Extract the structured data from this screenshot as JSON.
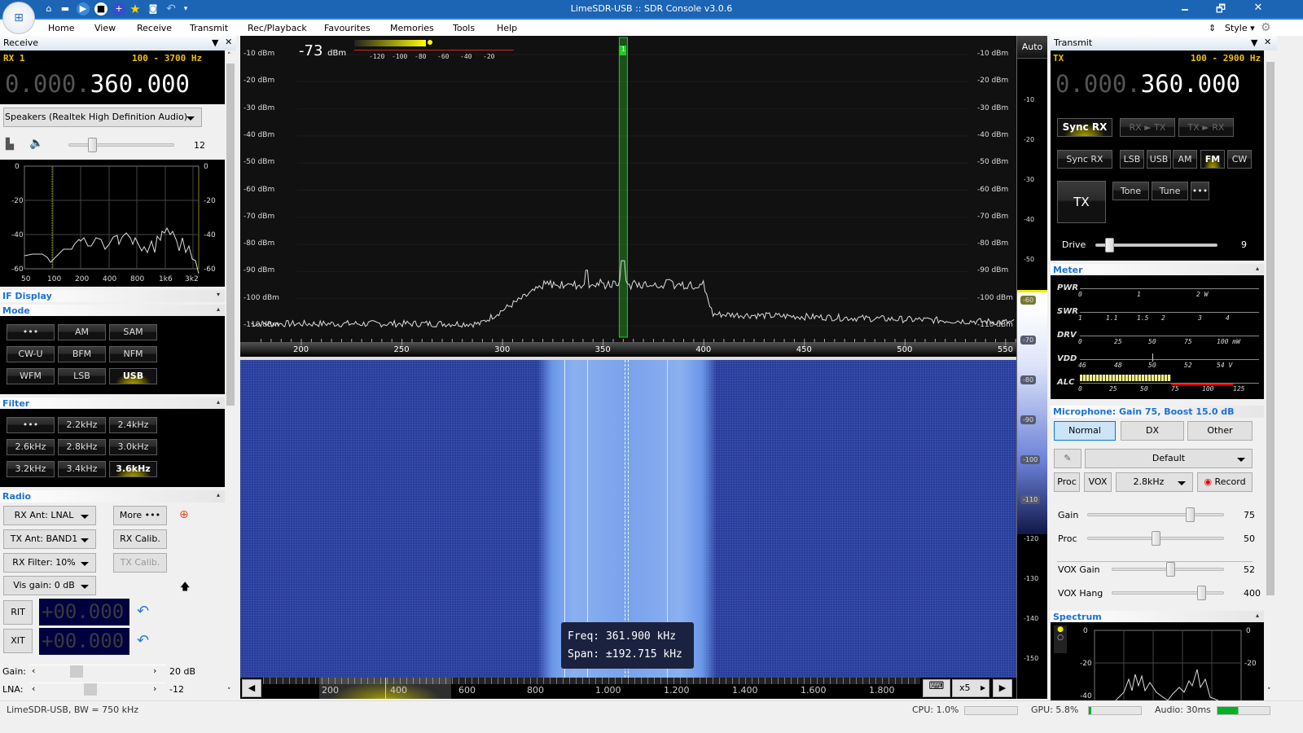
{
  "window": {
    "title": "LimeSDR-USB :: SDR Console v3.0.6",
    "minimize": "🗕",
    "restore": "🗗",
    "close": "✕"
  },
  "quick_access": [
    "home-icon",
    "folder-icon",
    "play-icon",
    "stop-icon",
    "add-icon",
    "favourite-star-icon",
    "camera-icon",
    "undo-icon"
  ],
  "menu": {
    "items": [
      "Home",
      "View",
      "Receive",
      "Transmit",
      "Rec/Playback",
      "Favourites",
      "Memories",
      "Tools",
      "Help"
    ],
    "style": "Style"
  },
  "receive": {
    "title": "Receive",
    "rx_label": "RX 1",
    "bandwidth": "100 - 3700 Hz",
    "freq_dim": "0.000.",
    "freq": "360.000",
    "audio_device": "Speakers (Realtek High Definition Audio)",
    "volume": "12",
    "volume_level": 0.22,
    "audio_y_labels": [
      "0",
      "-20",
      "-40",
      "-60"
    ],
    "audio_x_labels": [
      "50",
      "100",
      "200",
      "400",
      "800",
      "1k6",
      "3k2"
    ],
    "if_display": "IF Display",
    "mode_title": "Mode",
    "modes": [
      "•••",
      "AM",
      "SAM",
      "CW-U",
      "BFM",
      "NFM",
      "WFM",
      "LSB",
      "USB"
    ],
    "mode_selected": "USB",
    "filter_title": "Filter",
    "filters": [
      "•••",
      "2.2kHz",
      "2.4kHz",
      "2.6kHz",
      "2.8kHz",
      "3.0kHz",
      "3.2kHz",
      "3.4kHz",
      "3.6kHz"
    ],
    "filter_selected": "3.6kHz",
    "radio_title": "Radio",
    "rx_ant": "RX Ant: LNAL",
    "tx_ant": "TX Ant: BAND1",
    "rx_filter": "RX Filter: 10%",
    "vis_gain": "Vis gain: 0 dB",
    "more": "More •••",
    "rx_calib": "RX Calib.",
    "tx_calib": "TX Calib.",
    "rit": "RIT",
    "xit": "XIT",
    "rit_value": "+00.000",
    "xit_value": "+00.000",
    "gain_label": "Gain:",
    "gain_value": "20 dB",
    "lna_label": "LNA:",
    "lna_value": "-12"
  },
  "spectrum": {
    "level": "-73",
    "level_unit": "dBm",
    "meter_ticks": [
      "-120",
      "-100",
      "-80",
      "-60",
      "-40",
      "-20"
    ],
    "y_labels": [
      "-10 dBm",
      "-20 dBm",
      "-30 dBm",
      "-40 dBm",
      "-50 dBm",
      "-60 dBm",
      "-70 dBm",
      "-80 dBm",
      "-90 dBm",
      "-100 dBm",
      "-110 dBm"
    ],
    "x_labels": [
      "200",
      "250",
      "300",
      "350",
      "400",
      "450",
      "500",
      "550"
    ],
    "marker": "1",
    "auto": "Auto",
    "scale_labels": [
      "-10",
      "-20",
      "-30",
      "-40",
      "-50",
      "-60",
      "-70",
      "-80",
      "-90",
      "-100",
      "-110",
      "-120",
      "-130",
      "-140",
      "-150"
    ]
  },
  "waterfall": {
    "freq_label": "Freq:",
    "freq_value": "361.900 kHz",
    "span_label": "Span:",
    "span_value": "±192.715 kHz",
    "overview_labels": [
      "200",
      "400",
      "600",
      "800",
      "1.000",
      "1.200",
      "1.400",
      "1.600",
      "1.800"
    ],
    "zoom": "x5"
  },
  "transmit": {
    "title": "Transmit",
    "tx_label": "TX",
    "bandwidth": "100 - 2900 Hz",
    "freq_dim": "0.000.",
    "freq": "360.000",
    "sync_rx": "Sync RX",
    "rx_to_tx": "RX ► TX",
    "tx_to_rx": "TX ► RX",
    "sync_rx2": "Sync RX",
    "modes": [
      "LSB",
      "USB",
      "AM",
      "FM",
      "CW"
    ],
    "mode_selected": "FM",
    "tx": "TX",
    "tone": "Tone",
    "tune": "Tune",
    "more": "•••",
    "drive_label": "Drive",
    "drive_value": "9",
    "drive_level": 0.09
  },
  "meter": {
    "title": "Meter",
    "rows": [
      {
        "label": "PWR",
        "ticks": [
          "0",
          "1",
          "2 W"
        ]
      },
      {
        "label": "SWR",
        "ticks": [
          "1",
          "1.1",
          "1.5",
          "2",
          "3",
          "4"
        ]
      },
      {
        "label": "DRV",
        "ticks": [
          "0",
          "25",
          "50",
          "75",
          "100 mW"
        ]
      },
      {
        "label": "VDD",
        "ticks": [
          "46",
          "48",
          "50",
          "52",
          "54 V"
        ]
      },
      {
        "label": "ALC",
        "ticks": [
          "0",
          "25",
          "50",
          "75",
          "100",
          "125"
        ]
      }
    ]
  },
  "microphone": {
    "title": "Microphone: Gain 75, Boost 15.0 dB",
    "presets": [
      "Normal",
      "DX",
      "Other"
    ],
    "preset_selected": "Normal",
    "profile": "Default",
    "proc": "Proc",
    "vox": "VOX",
    "bandwidth": "2.8kHz",
    "record": "Record",
    "sliders": [
      {
        "label": "Gain",
        "value": "75",
        "level": 0.75
      },
      {
        "label": "Proc",
        "value": "50",
        "level": 0.5
      },
      {
        "label": "VOX Gain",
        "value": "52",
        "level": 0.52
      },
      {
        "label": "VOX Hang",
        "value": "400",
        "level": 0.8
      }
    ]
  },
  "spectrum_panel": {
    "title": "Spectrum",
    "y_labels": [
      "0",
      "-20",
      "-40"
    ]
  },
  "status": {
    "device": "LimeSDR-USB, BW = 750 kHz",
    "cpu": "CPU: 1.0%",
    "gpu": "GPU: 5.8%",
    "audio": "Audio: 30ms"
  },
  "colors": {
    "titlebar": "#1c64b4",
    "accent": "#1c72d4",
    "rx_label": "#f0c000",
    "waterfall": "#2a3f9a"
  }
}
